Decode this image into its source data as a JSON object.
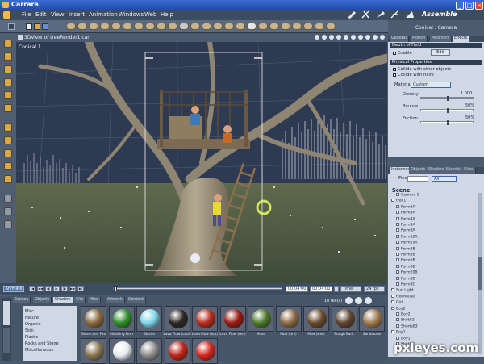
{
  "window": {
    "title": "Carrara",
    "controls": [
      "_",
      "□",
      "×"
    ]
  },
  "menu": [
    "File",
    "Edit",
    "View",
    "Insert",
    "Animation",
    "Windows",
    "Web",
    "Help"
  ],
  "room": {
    "label": "Assemble"
  },
  "viewport": {
    "title": "3DView of treeRender1.car",
    "camera": "Conical 1"
  },
  "properties": {
    "title": "Conical : Camera",
    "tabs": [
      "General",
      "Motion",
      "Modifiers",
      "Effects"
    ],
    "active_tab": "Effects",
    "depth_of_field": {
      "header": "Depth of Field",
      "enable_label": "Enable",
      "edit_label": "Edit"
    },
    "physical": {
      "header": "Physical Properties",
      "collide_objects": "Collide with other objects",
      "collide_hairs": "Collide with hairs",
      "material_label": "Material",
      "material_value": "Custom",
      "density_label": "Density",
      "density_value": "1.000",
      "bounce_label": "Bounce",
      "bounce_value": "50%",
      "friction_label": "Friction",
      "friction_value": "50%",
      "density_level": 0.5,
      "bounce_level": 0.5,
      "friction_level": 0.5
    }
  },
  "browser": {
    "tabs": [
      "Instances",
      "Objects",
      "Shaders",
      "Sounds",
      "Clips"
    ],
    "find_label": "Find",
    "find_value": "",
    "find_scope": "All",
    "scene_title": "Scene",
    "tree": [
      {
        "label": "Camera 1",
        "depth": 1
      },
      {
        "label": "tree1",
        "depth": 0
      },
      {
        "label": "Form2A",
        "depth": 1
      },
      {
        "label": "Form3A",
        "depth": 1
      },
      {
        "label": "Form4A",
        "depth": 1
      },
      {
        "label": "Form3A",
        "depth": 1
      },
      {
        "label": "Form8A",
        "depth": 1
      },
      {
        "label": "Form12A",
        "depth": 1
      },
      {
        "label": "Form20A",
        "depth": 1
      },
      {
        "label": "Form2B",
        "depth": 1
      },
      {
        "label": "Form3B",
        "depth": 1
      },
      {
        "label": "Form5B",
        "depth": 1
      },
      {
        "label": "Form8B",
        "depth": 1
      },
      {
        "label": "Form20B",
        "depth": 1
      },
      {
        "label": "Form8B",
        "depth": 1
      },
      {
        "label": "Form8C",
        "depth": 1
      },
      {
        "label": "Sun Light",
        "depth": 0
      },
      {
        "label": "treehouse",
        "depth": 0
      },
      {
        "label": "Girl",
        "depth": 0
      },
      {
        "label": "Boy2",
        "depth": 0
      },
      {
        "label": "Boy2",
        "depth": 1
      },
      {
        "label": "Shirt82",
        "depth": 1
      },
      {
        "label": "Shorts83",
        "depth": 1
      },
      {
        "label": "Boy1",
        "depth": 0
      },
      {
        "label": "Boy1",
        "depth": 1
      },
      {
        "label": "Shirt80",
        "depth": 1
      }
    ]
  },
  "timeline": {
    "animate_label": "Animate",
    "transport": [
      "|◀",
      "◀◀",
      "◀|",
      "▶",
      "|▶",
      "▶▶",
      "▶|"
    ],
    "time_current": "00:04:00",
    "time_end": "00:04:00",
    "time_unit": "Time",
    "fps": "24 fps"
  },
  "shelf": {
    "tabs": [
      "Scenes",
      "Objects",
      "Shaders",
      "Clip",
      "Misc",
      "Artwork",
      "Content"
    ],
    "active_tab": "Shaders",
    "categories": [
      "Misc",
      "Nature",
      "Organic",
      "Skin",
      "Plastic",
      "Rocks and Stone",
      "Miscellaneous"
    ],
    "thumb_count": "10 file(s)",
    "thumbs": [
      {
        "label": "Stone and Fire",
        "color": "#8a6a3c"
      },
      {
        "label": "Climbing Fern",
        "color": "#2f8d2a"
      },
      {
        "label": "Glacier",
        "color": "#7fd6e8"
      },
      {
        "label": "Lava Flow (cool)",
        "color": "#2c2624"
      },
      {
        "label": "Lava Flow (hot)",
        "color": "#b82b1c"
      },
      {
        "label": "Lava Flow (red)",
        "color": "#9a1a12"
      },
      {
        "label": "Moss",
        "color": "#4e7a2a"
      },
      {
        "label": "Mud (dry)",
        "color": "#8c6a45"
      },
      {
        "label": "Mud (wet)",
        "color": "#6a4a2c"
      },
      {
        "label": "Rough Bark",
        "color": "#5e4530"
      },
      {
        "label": "Sandstone",
        "color": "#a07a4e"
      },
      {
        "label": "",
        "color": "#8a7650"
      },
      {
        "label": "",
        "color": "#e8ecf2"
      },
      {
        "label": "",
        "color": "#8d8d8d"
      },
      {
        "label": "",
        "color": "#c02418"
      },
      {
        "label": "",
        "color": "#d5261c"
      }
    ]
  },
  "watermark": "pxleyes.com"
}
